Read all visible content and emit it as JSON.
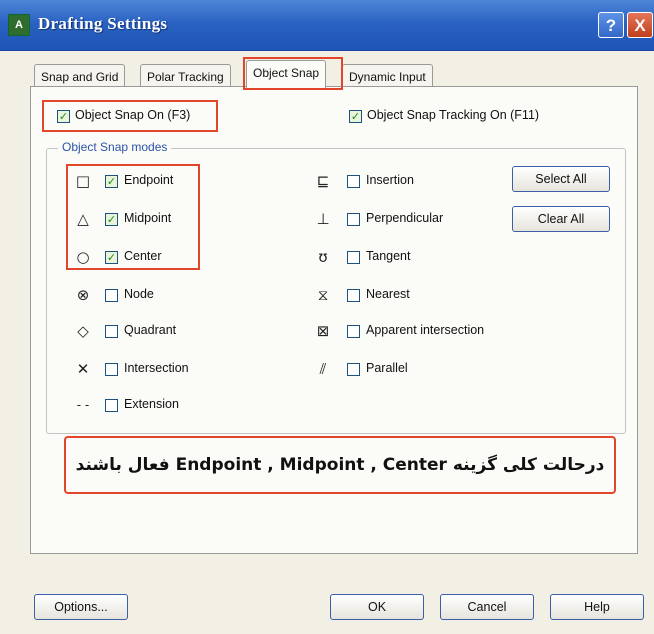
{
  "window": {
    "icon_text": "A",
    "title": "Drafting Settings",
    "help_glyph": "?",
    "close_glyph": "X"
  },
  "tabs": [
    {
      "label": "Snap and Grid"
    },
    {
      "label": "Polar Tracking"
    },
    {
      "label": "Object Snap",
      "active": true
    },
    {
      "label": "Dynamic Input"
    }
  ],
  "object_snap_on": {
    "label": "Object Snap On (F3)",
    "checked": true
  },
  "object_snap_tracking_on": {
    "label": "Object Snap Tracking On (F11)",
    "checked": true
  },
  "modes_group_title": "Object Snap modes",
  "modes_left": [
    {
      "symbol": "□",
      "label": "Endpoint",
      "checked": true
    },
    {
      "symbol": "△",
      "label": "Midpoint",
      "checked": true
    },
    {
      "symbol": "○",
      "label": "Center",
      "checked": true
    },
    {
      "symbol": "⊗",
      "label": "Node",
      "checked": false
    },
    {
      "symbol": "◇",
      "label": "Quadrant",
      "checked": false
    },
    {
      "symbol": "✕",
      "label": "Intersection",
      "checked": false
    },
    {
      "symbol": "‐ ‐",
      "label": "Extension",
      "checked": false
    }
  ],
  "modes_right": [
    {
      "symbol": "⊑",
      "label": "Insertion",
      "checked": false
    },
    {
      "symbol": "⊥",
      "label": "Perpendicular",
      "checked": false
    },
    {
      "symbol": "ʊ",
      "label": "Tangent",
      "checked": false
    },
    {
      "symbol": "⧖",
      "label": "Nearest",
      "checked": false
    },
    {
      "symbol": "⊠",
      "label": "Apparent intersection",
      "checked": false
    },
    {
      "symbol": "⫽",
      "label": "Parallel",
      "checked": false
    }
  ],
  "buttons": {
    "select_all": "Select All",
    "clear_all": "Clear All",
    "options": "Options...",
    "ok": "OK",
    "cancel": "Cancel",
    "help": "Help"
  },
  "annotation_text": "درحالت کلی گزینه Endpoint , Midpoint , Center فعال باشند",
  "colors": {
    "highlight": "#e2462a",
    "titlebar": "#2a62c2",
    "group_title": "#2a53a8"
  }
}
